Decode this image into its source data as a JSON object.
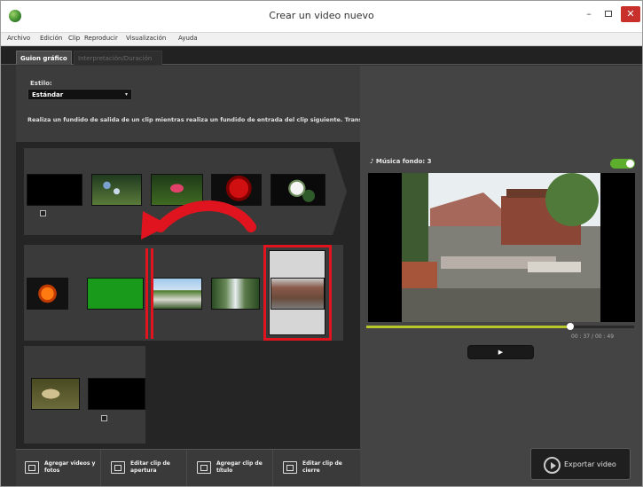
{
  "window": {
    "title": "Crear un video nuevo",
    "minimize_glyph": "–",
    "close_glyph": "✕",
    "app_icon": "app-icon"
  },
  "menu": [
    "Archivo",
    "Edición",
    "Clip",
    "Reproducir",
    "Visualización",
    "Ayuda"
  ],
  "tabs": {
    "active": "Guion gráfico",
    "inactive": "Interpretación/Duración"
  },
  "style": {
    "label": "Estilo:",
    "selected": "Estándar",
    "caret": "▾",
    "description": "Realiza un fundido de salida de un clip mientras realiza un fundido de entrada del clip siguiente. Transición"
  },
  "music": {
    "label": "♪ Música fondo: 3",
    "toggle_on": true
  },
  "playback": {
    "time": "00 : 37  /  00 : 49",
    "progress": 0.76,
    "play_glyph": "▶"
  },
  "toolbar": [
    {
      "label": "Agregar videos y fotos",
      "icon": "add-media-icon"
    },
    {
      "label": "Editar clip de apertura",
      "icon": "opening-clip-icon"
    },
    {
      "label": "Agregar clip de título",
      "icon": "title-clip-icon"
    },
    {
      "label": "Editar clip de cierre",
      "icon": "closing-clip-icon"
    }
  ],
  "export": {
    "label": "Exportar video",
    "icon": "film-reel-icon"
  },
  "colors": {
    "highlight": "#e0141e",
    "toggle": "#5cae2c",
    "progress": "#b8c82a"
  }
}
